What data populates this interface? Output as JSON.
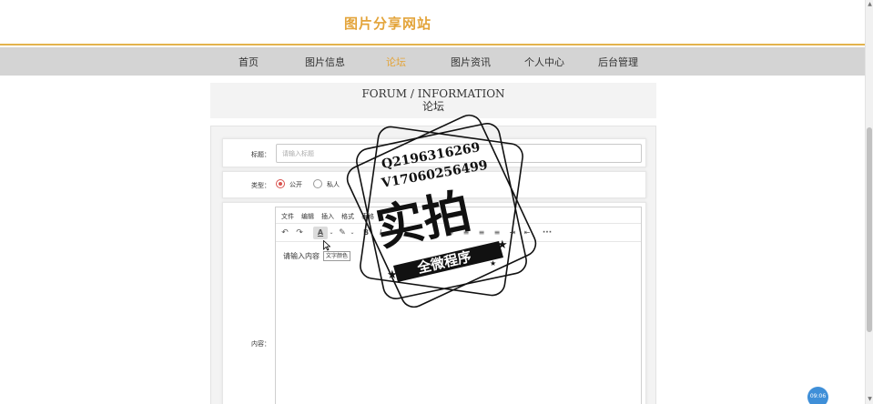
{
  "site": {
    "title": "图片分享网站"
  },
  "nav": {
    "items": [
      {
        "label": "首页",
        "active": false
      },
      {
        "label": "图片信息",
        "active": false
      },
      {
        "label": "论坛",
        "active": true
      },
      {
        "label": "图片资讯",
        "active": false
      },
      {
        "label": "个人中心",
        "active": false
      },
      {
        "label": "后台管理",
        "active": false
      }
    ]
  },
  "section": {
    "title_en": "FORUM / INFORMATION",
    "title_cn": "论坛"
  },
  "form": {
    "title_label": "标题：",
    "title_placeholder": "请输入标题",
    "type_label": "类型：",
    "type_options": [
      {
        "label": "公开",
        "checked": true
      },
      {
        "label": "私人",
        "checked": false
      }
    ],
    "content_label": "内容："
  },
  "editor": {
    "menu": [
      "文件",
      "编辑",
      "插入",
      "格式",
      "表格"
    ],
    "toolbar_icons": [
      "undo-icon",
      "redo-icon",
      "text-color-icon",
      "highlight-icon",
      "bold-icon",
      "italic-icon",
      "align-left-icon",
      "align-center-icon",
      "align-right-icon",
      "align-justify-icon",
      "indent-icon",
      "more-icon"
    ],
    "placeholder": "请输入内容",
    "tooltip": "文字颜色",
    "accent_color": "#d9534f"
  },
  "watermark": {
    "line1": "Q2196316269",
    "line2": "V17060256499",
    "main": "实拍",
    "ribbon": "全微程序"
  },
  "clock": {
    "time": "09:06"
  },
  "colors": {
    "brand": "#e3a43a",
    "nav_bg": "#d4d4d4",
    "panel_bg": "#f3f3f3"
  }
}
